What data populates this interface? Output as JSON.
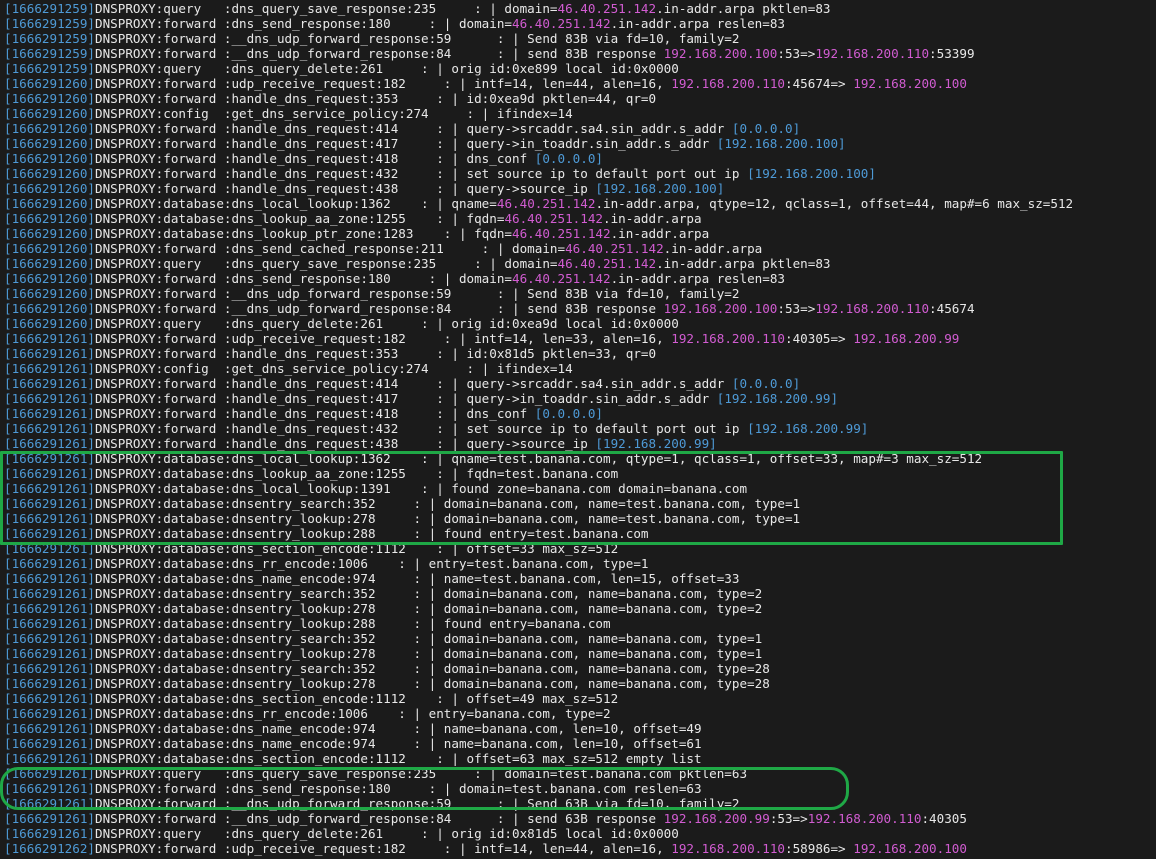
{
  "colors": {
    "background": "#1b1b1b",
    "text": "#e8e8e8",
    "timestamp": "#4e9ad6",
    "ip_address": "#d15cd1",
    "bracketed_ip": "#4e9ad6",
    "highlight": "#1fa846"
  },
  "log_lines": [
    [
      [
        "ts",
        "[1666291259]"
      ],
      [
        "pl",
        "DNSPROXY:query   :dns_query_save_response:235     : | domain="
      ],
      [
        "mg",
        "46.40.251.142"
      ],
      [
        "pl",
        ".in-addr.arpa pktlen=83"
      ]
    ],
    [
      [
        "ts",
        "[1666291259]"
      ],
      [
        "pl",
        "DNSPROXY:forward :dns_send_response:180     : | domain="
      ],
      [
        "mg",
        "46.40.251.142"
      ],
      [
        "pl",
        ".in-addr.arpa reslen=83"
      ]
    ],
    [
      [
        "ts",
        "[1666291259]"
      ],
      [
        "pl",
        "DNSPROXY:forward :__dns_udp_forward_response:59      : | Send 83B via fd=10, family=2"
      ]
    ],
    [
      [
        "ts",
        "[1666291259]"
      ],
      [
        "pl",
        "DNSPROXY:forward :__dns_udp_forward_response:84      : | send 83B response "
      ],
      [
        "mg",
        "192.168.200.100"
      ],
      [
        "pl",
        ":53=>"
      ],
      [
        "mg",
        "192.168.200.110"
      ],
      [
        "pl",
        ":53399"
      ]
    ],
    [
      [
        "ts",
        "[1666291259]"
      ],
      [
        "pl",
        "DNSPROXY:query   :dns_query_delete:261     : | orig id:0xe899 local id:0x0000"
      ]
    ],
    [
      [
        "ts",
        "[1666291260]"
      ],
      [
        "pl",
        "DNSPROXY:forward :udp_receive_request:182     : | intf=14, len=44, alen=16, "
      ],
      [
        "mg",
        "192.168.200.110"
      ],
      [
        "pl",
        ":45674=> "
      ],
      [
        "mg",
        "192.168.200.100"
      ]
    ],
    [
      [
        "ts",
        "[1666291260]"
      ],
      [
        "pl",
        "DNSPROXY:forward :handle_dns_request:353     : | id:0xea9d pktlen=44, qr=0"
      ]
    ],
    [
      [
        "ts",
        "[1666291260]"
      ],
      [
        "pl",
        "DNSPROXY:config  :get_dns_service_policy:274     : | ifindex=14"
      ]
    ],
    [
      [
        "ts",
        "[1666291260]"
      ],
      [
        "pl",
        "DNSPROXY:forward :handle_dns_request:414     : | query->srcaddr.sa4.sin_addr.s_addr "
      ],
      [
        "bl",
        "[0.0.0.0]"
      ]
    ],
    [
      [
        "ts",
        "[1666291260]"
      ],
      [
        "pl",
        "DNSPROXY:forward :handle_dns_request:417     : | query->in_toaddr.sin_addr.s_addr "
      ],
      [
        "bl",
        "[192.168.200.100]"
      ]
    ],
    [
      [
        "ts",
        "[1666291260]"
      ],
      [
        "pl",
        "DNSPROXY:forward :handle_dns_request:418     : | dns_conf "
      ],
      [
        "bl",
        "[0.0.0.0]"
      ]
    ],
    [
      [
        "ts",
        "[1666291260]"
      ],
      [
        "pl",
        "DNSPROXY:forward :handle_dns_request:432     : | set source ip to default port out ip "
      ],
      [
        "bl",
        "[192.168.200.100]"
      ]
    ],
    [
      [
        "ts",
        "[1666291260]"
      ],
      [
        "pl",
        "DNSPROXY:forward :handle_dns_request:438     : | query->source_ip "
      ],
      [
        "bl",
        "[192.168.200.100]"
      ]
    ],
    [
      [
        "ts",
        "[1666291260]"
      ],
      [
        "pl",
        "DNSPROXY:database:dns_local_lookup:1362    : | qname="
      ],
      [
        "mg",
        "46.40.251.142"
      ],
      [
        "pl",
        ".in-addr.arpa, qtype=12, qclass=1, offset=44, map#=6 max_sz=512"
      ]
    ],
    [
      [
        "ts",
        "[1666291260]"
      ],
      [
        "pl",
        "DNSPROXY:database:dns_lookup_aa_zone:1255    : | fqdn="
      ],
      [
        "mg",
        "46.40.251.142"
      ],
      [
        "pl",
        ".in-addr.arpa"
      ]
    ],
    [
      [
        "ts",
        "[1666291260]"
      ],
      [
        "pl",
        "DNSPROXY:database:dns_lookup_ptr_zone:1283    : | fqdn="
      ],
      [
        "mg",
        "46.40.251.142"
      ],
      [
        "pl",
        ".in-addr.arpa"
      ]
    ],
    [
      [
        "ts",
        "[1666291260]"
      ],
      [
        "pl",
        "DNSPROXY:forward :dns_send_cached_response:211     : | domain="
      ],
      [
        "mg",
        "46.40.251.142"
      ],
      [
        "pl",
        ".in-addr.arpa"
      ]
    ],
    [
      [
        "ts",
        "[1666291260]"
      ],
      [
        "pl",
        "DNSPROXY:query   :dns_query_save_response:235     : | domain="
      ],
      [
        "mg",
        "46.40.251.142"
      ],
      [
        "pl",
        ".in-addr.arpa pktlen=83"
      ]
    ],
    [
      [
        "ts",
        "[1666291260]"
      ],
      [
        "pl",
        "DNSPROXY:forward :dns_send_response:180     : | domain="
      ],
      [
        "mg",
        "46.40.251.142"
      ],
      [
        "pl",
        ".in-addr.arpa reslen=83"
      ]
    ],
    [
      [
        "ts",
        "[1666291260]"
      ],
      [
        "pl",
        "DNSPROXY:forward :__dns_udp_forward_response:59      : | Send 83B via fd=10, family=2"
      ]
    ],
    [
      [
        "ts",
        "[1666291260]"
      ],
      [
        "pl",
        "DNSPROXY:forward :__dns_udp_forward_response:84      : | send 83B response "
      ],
      [
        "mg",
        "192.168.200.100"
      ],
      [
        "pl",
        ":53=>"
      ],
      [
        "mg",
        "192.168.200.110"
      ],
      [
        "pl",
        ":45674"
      ]
    ],
    [
      [
        "ts",
        "[1666291260]"
      ],
      [
        "pl",
        "DNSPROXY:query   :dns_query_delete:261     : | orig id:0xea9d local id:0x0000"
      ]
    ],
    [
      [
        "ts",
        "[1666291261]"
      ],
      [
        "pl",
        "DNSPROXY:forward :udp_receive_request:182     : | intf=14, len=33, alen=16, "
      ],
      [
        "mg",
        "192.168.200.110"
      ],
      [
        "pl",
        ":40305=> "
      ],
      [
        "mg",
        "192.168.200.99"
      ]
    ],
    [
      [
        "ts",
        "[1666291261]"
      ],
      [
        "pl",
        "DNSPROXY:forward :handle_dns_request:353     : | id:0x81d5 pktlen=33, qr=0"
      ]
    ],
    [
      [
        "ts",
        "[1666291261]"
      ],
      [
        "pl",
        "DNSPROXY:config  :get_dns_service_policy:274     : | ifindex=14"
      ]
    ],
    [
      [
        "ts",
        "[1666291261]"
      ],
      [
        "pl",
        "DNSPROXY:forward :handle_dns_request:414     : | query->srcaddr.sa4.sin_addr.s_addr "
      ],
      [
        "bl",
        "[0.0.0.0]"
      ]
    ],
    [
      [
        "ts",
        "[1666291261]"
      ],
      [
        "pl",
        "DNSPROXY:forward :handle_dns_request:417     : | query->in_toaddr.sin_addr.s_addr "
      ],
      [
        "bl",
        "[192.168.200.99]"
      ]
    ],
    [
      [
        "ts",
        "[1666291261]"
      ],
      [
        "pl",
        "DNSPROXY:forward :handle_dns_request:418     : | dns_conf "
      ],
      [
        "bl",
        "[0.0.0.0]"
      ]
    ],
    [
      [
        "ts",
        "[1666291261]"
      ],
      [
        "pl",
        "DNSPROXY:forward :handle_dns_request:432     : | set source ip to default port out ip "
      ],
      [
        "bl",
        "[192.168.200.99]"
      ]
    ],
    [
      [
        "ts",
        "[1666291261]"
      ],
      [
        "pl",
        "DNSPROXY:forward :handle_dns_request:438     : | query->source_ip "
      ],
      [
        "bl",
        "[192.168.200.99]"
      ]
    ],
    [
      [
        "ts",
        "[1666291261]"
      ],
      [
        "pl",
        "DNSPROXY:database:dns_local_lookup:1362    : | qname=test.banana.com, qtype=1, qclass=1, offset=33, map#=3 max_sz=512"
      ]
    ],
    [
      [
        "ts",
        "[1666291261]"
      ],
      [
        "pl",
        "DNSPROXY:database:dns_lookup_aa_zone:1255    : | fqdn=test.banana.com"
      ]
    ],
    [
      [
        "ts",
        "[1666291261]"
      ],
      [
        "pl",
        "DNSPROXY:database:dns_local_lookup:1391    : | found zone=banana.com domain=banana.com"
      ]
    ],
    [
      [
        "ts",
        "[1666291261]"
      ],
      [
        "pl",
        "DNSPROXY:database:dnsentry_search:352     : | domain=banana.com, name=test.banana.com, type=1"
      ]
    ],
    [
      [
        "ts",
        "[1666291261]"
      ],
      [
        "pl",
        "DNSPROXY:database:dnsentry_lookup:278     : | domain=banana.com, name=test.banana.com, type=1"
      ]
    ],
    [
      [
        "ts",
        "[1666291261]"
      ],
      [
        "pl",
        "DNSPROXY:database:dnsentry_lookup:288     : | found entry=test.banana.com"
      ]
    ],
    [
      [
        "ts",
        "[1666291261]"
      ],
      [
        "pl",
        "DNSPROXY:database:dns_section_encode:1112    : | offset=33 max_sz=512"
      ]
    ],
    [
      [
        "ts",
        "[1666291261]"
      ],
      [
        "pl",
        "DNSPROXY:database:dns_rr_encode:1006    : | entry=test.banana.com, type=1"
      ]
    ],
    [
      [
        "ts",
        "[1666291261]"
      ],
      [
        "pl",
        "DNSPROXY:database:dns_name_encode:974     : | name=test.banana.com, len=15, offset=33"
      ]
    ],
    [
      [
        "ts",
        "[1666291261]"
      ],
      [
        "pl",
        "DNSPROXY:database:dnsentry_search:352     : | domain=banana.com, name=banana.com, type=2"
      ]
    ],
    [
      [
        "ts",
        "[1666291261]"
      ],
      [
        "pl",
        "DNSPROXY:database:dnsentry_lookup:278     : | domain=banana.com, name=banana.com, type=2"
      ]
    ],
    [
      [
        "ts",
        "[1666291261]"
      ],
      [
        "pl",
        "DNSPROXY:database:dnsentry_lookup:288     : | found entry=banana.com"
      ]
    ],
    [
      [
        "ts",
        "[1666291261]"
      ],
      [
        "pl",
        "DNSPROXY:database:dnsentry_search:352     : | domain=banana.com, name=banana.com, type=1"
      ]
    ],
    [
      [
        "ts",
        "[1666291261]"
      ],
      [
        "pl",
        "DNSPROXY:database:dnsentry_lookup:278     : | domain=banana.com, name=banana.com, type=1"
      ]
    ],
    [
      [
        "ts",
        "[1666291261]"
      ],
      [
        "pl",
        "DNSPROXY:database:dnsentry_search:352     : | domain=banana.com, name=banana.com, type=28"
      ]
    ],
    [
      [
        "ts",
        "[1666291261]"
      ],
      [
        "pl",
        "DNSPROXY:database:dnsentry_lookup:278     : | domain=banana.com, name=banana.com, type=28"
      ]
    ],
    [
      [
        "ts",
        "[1666291261]"
      ],
      [
        "pl",
        "DNSPROXY:database:dns_section_encode:1112    : | offset=49 max_sz=512"
      ]
    ],
    [
      [
        "ts",
        "[1666291261]"
      ],
      [
        "pl",
        "DNSPROXY:database:dns_rr_encode:1006    : | entry=banana.com, type=2"
      ]
    ],
    [
      [
        "ts",
        "[1666291261]"
      ],
      [
        "pl",
        "DNSPROXY:database:dns_name_encode:974     : | name=banana.com, len=10, offset=49"
      ]
    ],
    [
      [
        "ts",
        "[1666291261]"
      ],
      [
        "pl",
        "DNSPROXY:database:dns_name_encode:974     : | name=banana.com, len=10, offset=61"
      ]
    ],
    [
      [
        "ts",
        "[1666291261]"
      ],
      [
        "pl",
        "DNSPROXY:database:dns_section_encode:1112    : | offset=63 max_sz=512 empty list"
      ]
    ],
    [
      [
        "ts",
        "[1666291261]"
      ],
      [
        "pl",
        "DNSPROXY:query   :dns_query_save_response:235     : | domain=test.banana.com pktlen=63"
      ]
    ],
    [
      [
        "ts",
        "[1666291261]"
      ],
      [
        "pl",
        "DNSPROXY:forward :dns_send_response:180     : | domain=test.banana.com reslen=63"
      ]
    ],
    [
      [
        "ts",
        "[1666291261]"
      ],
      [
        "pl",
        "DNSPROXY:forward :__dns_udp_forward_response:59      : | Send 63B via fd=10, family=2"
      ]
    ],
    [
      [
        "ts",
        "[1666291261]"
      ],
      [
        "pl",
        "DNSPROXY:forward :__dns_udp_forward_response:84      : | send 63B response "
      ],
      [
        "mg",
        "192.168.200.99"
      ],
      [
        "pl",
        ":53=>"
      ],
      [
        "mg",
        "192.168.200.110"
      ],
      [
        "pl",
        ":40305"
      ]
    ],
    [
      [
        "ts",
        "[1666291261]"
      ],
      [
        "pl",
        "DNSPROXY:query   :dns_query_delete:261     : | orig id:0x81d5 local id:0x0000"
      ]
    ],
    [
      [
        "ts",
        "[1666291262]"
      ],
      [
        "pl",
        "DNSPROXY:forward :udp_receive_request:182     : | intf=14, len=44, alen=16, "
      ],
      [
        "mg",
        "192.168.200.110"
      ],
      [
        "pl",
        ":58986=> "
      ],
      [
        "mg",
        "192.168.200.100"
      ]
    ]
  ]
}
